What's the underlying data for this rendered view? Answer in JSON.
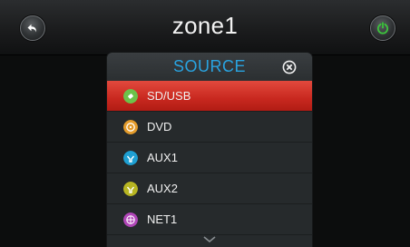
{
  "header": {
    "title": "zone1",
    "back_icon": "back-arrow-icon",
    "power_icon": "power-icon",
    "power_color": "#3dc23d"
  },
  "source_menu": {
    "title": "SOURCE",
    "title_color": "#29a3e0",
    "close_icon": "close-icon",
    "selected_color": "#d0332a",
    "items": [
      {
        "label": "SD/USB",
        "icon": "usb-icon",
        "icon_color": "#6cc24a",
        "selected": true
      },
      {
        "label": "DVD",
        "icon": "disc-icon",
        "icon_color": "#e39b2b",
        "selected": false
      },
      {
        "label": "AUX1",
        "icon": "aux-plug-icon",
        "icon_color": "#1e9fd2",
        "selected": false
      },
      {
        "label": "AUX2",
        "icon": "aux-plug-icon",
        "icon_color": "#b7b522",
        "selected": false
      },
      {
        "label": "NET1",
        "icon": "network-icon",
        "icon_color": "#b046b7",
        "selected": false
      }
    ],
    "more_icon": "chevron-down-icon"
  }
}
